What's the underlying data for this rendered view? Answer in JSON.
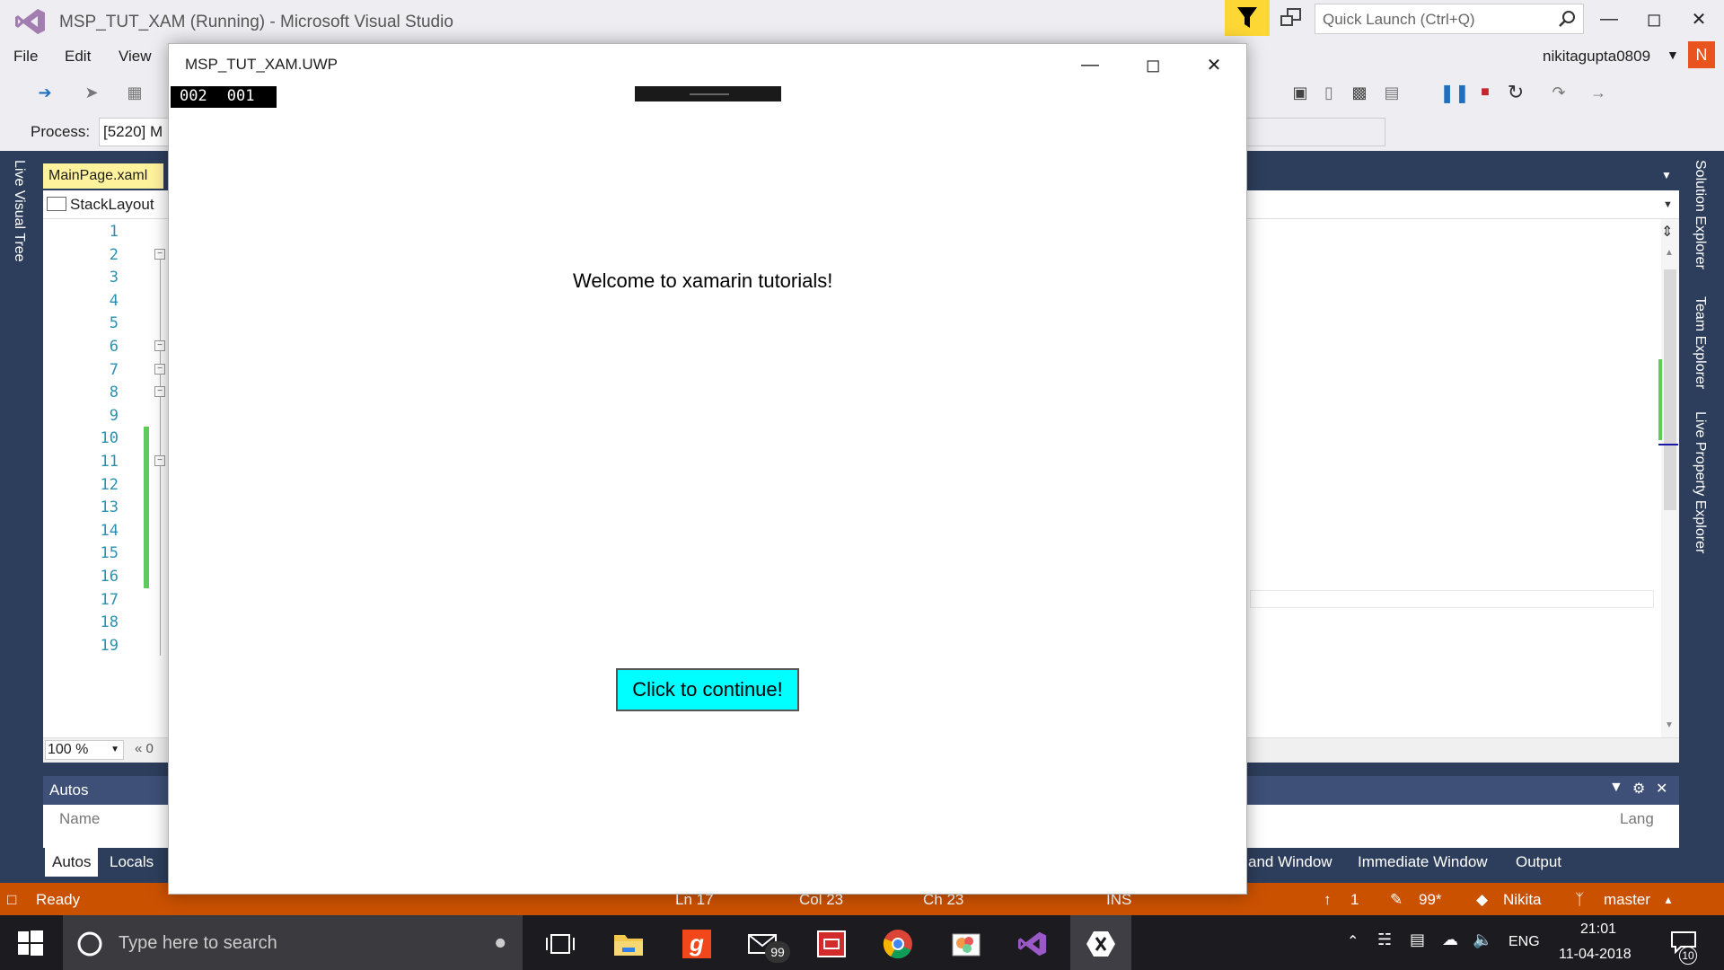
{
  "vs": {
    "window_title": "MSP_TUT_XAM (Running) - Microsoft Visual Studio",
    "quick_launch_placeholder": "Quick Launch (Ctrl+Q)",
    "menu": {
      "file": "File",
      "edit": "Edit",
      "view": "View"
    },
    "user_name": "nikitagupta0809",
    "user_initial": "N",
    "process_label": "Process:",
    "process_value": "[5220] M",
    "left_tool_tab": "Live Visual Tree",
    "right_tool_tabs": [
      "Solution Explorer",
      "Team Explorer",
      "Live Property Explorer"
    ],
    "editor": {
      "tab_label": "MainPage.xaml",
      "nav_element": "StackLayout",
      "line_numbers": [
        "1",
        "2",
        "3",
        "4",
        "5",
        "6",
        "7",
        "8",
        "9",
        "10",
        "11",
        "12",
        "13",
        "14",
        "15",
        "16",
        "17",
        "18",
        "19"
      ],
      "zoom": "100 %",
      "zoom_next": "0"
    },
    "autos": {
      "title": "Autos",
      "col_name": "Name",
      "col_lang": "Lang",
      "tabs": [
        "Autos",
        "Locals"
      ],
      "right_tabs": [
        "and Window",
        "Immediate Window",
        "Output"
      ]
    },
    "status": {
      "ready": "Ready",
      "ln": "Ln 17",
      "col": "Col 23",
      "ch": "Ch 23",
      "ins": "INS",
      "push_count": "1",
      "pending_changes": "99*",
      "repo_user": "Nikita",
      "branch": "master"
    },
    "colors": {
      "status_bar": "#ca5100",
      "accent_tab": "#fff29d",
      "app_button": "#00ffff"
    }
  },
  "app": {
    "title": "MSP_TUT_XAM.UWP",
    "frame_counter": [
      "002",
      "001"
    ],
    "welcome_text": "Welcome to xamarin tutorials!",
    "button_label": "Click to continue!"
  },
  "taskbar": {
    "search_placeholder": "Type here to search",
    "mail_badge": "99",
    "language": "ENG",
    "time": "21:01",
    "date": "11-04-2018",
    "notification_count": "10",
    "apps": [
      "task-view",
      "file-explorer",
      "g-app",
      "mail",
      "news",
      "chrome",
      "paint",
      "visual-studio",
      "xamarin"
    ]
  }
}
